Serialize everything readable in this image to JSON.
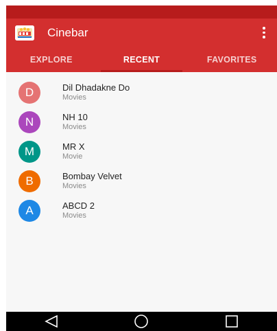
{
  "app": {
    "title": "Cinebar",
    "overflow_icon": "more-vert-icon",
    "logo_icon": "cinema-logo-icon"
  },
  "colors": {
    "primary": "#d32f2f",
    "primary_dark": "#b71c1c",
    "avatar_d": "#e57373",
    "avatar_n": "#ab47bc",
    "avatar_m": "#009688",
    "avatar_b": "#ef6c00",
    "avatar_a": "#1e88e5"
  },
  "tabs": [
    {
      "label": "EXPLORE",
      "active": false
    },
    {
      "label": "RECENT",
      "active": true
    },
    {
      "label": "FAVORITES",
      "active": false
    }
  ],
  "items": [
    {
      "initial": "D",
      "title": "Dil Dhadakne Do",
      "subtitle": "Movies",
      "color": "#e57373"
    },
    {
      "initial": "N",
      "title": "NH 10",
      "subtitle": "Movies",
      "color": "#ab47bc"
    },
    {
      "initial": "M",
      "title": "MR X",
      "subtitle": "Movie",
      "color": "#009688"
    },
    {
      "initial": "B",
      "title": "Bombay Velvet",
      "subtitle": "Movies",
      "color": "#ef6c00"
    },
    {
      "initial": "A",
      "title": "ABCD 2",
      "subtitle": "Movies",
      "color": "#1e88e5"
    }
  ],
  "nav": {
    "back_icon": "back-triangle-icon",
    "home_icon": "home-circle-icon",
    "recents_icon": "recents-square-icon"
  }
}
